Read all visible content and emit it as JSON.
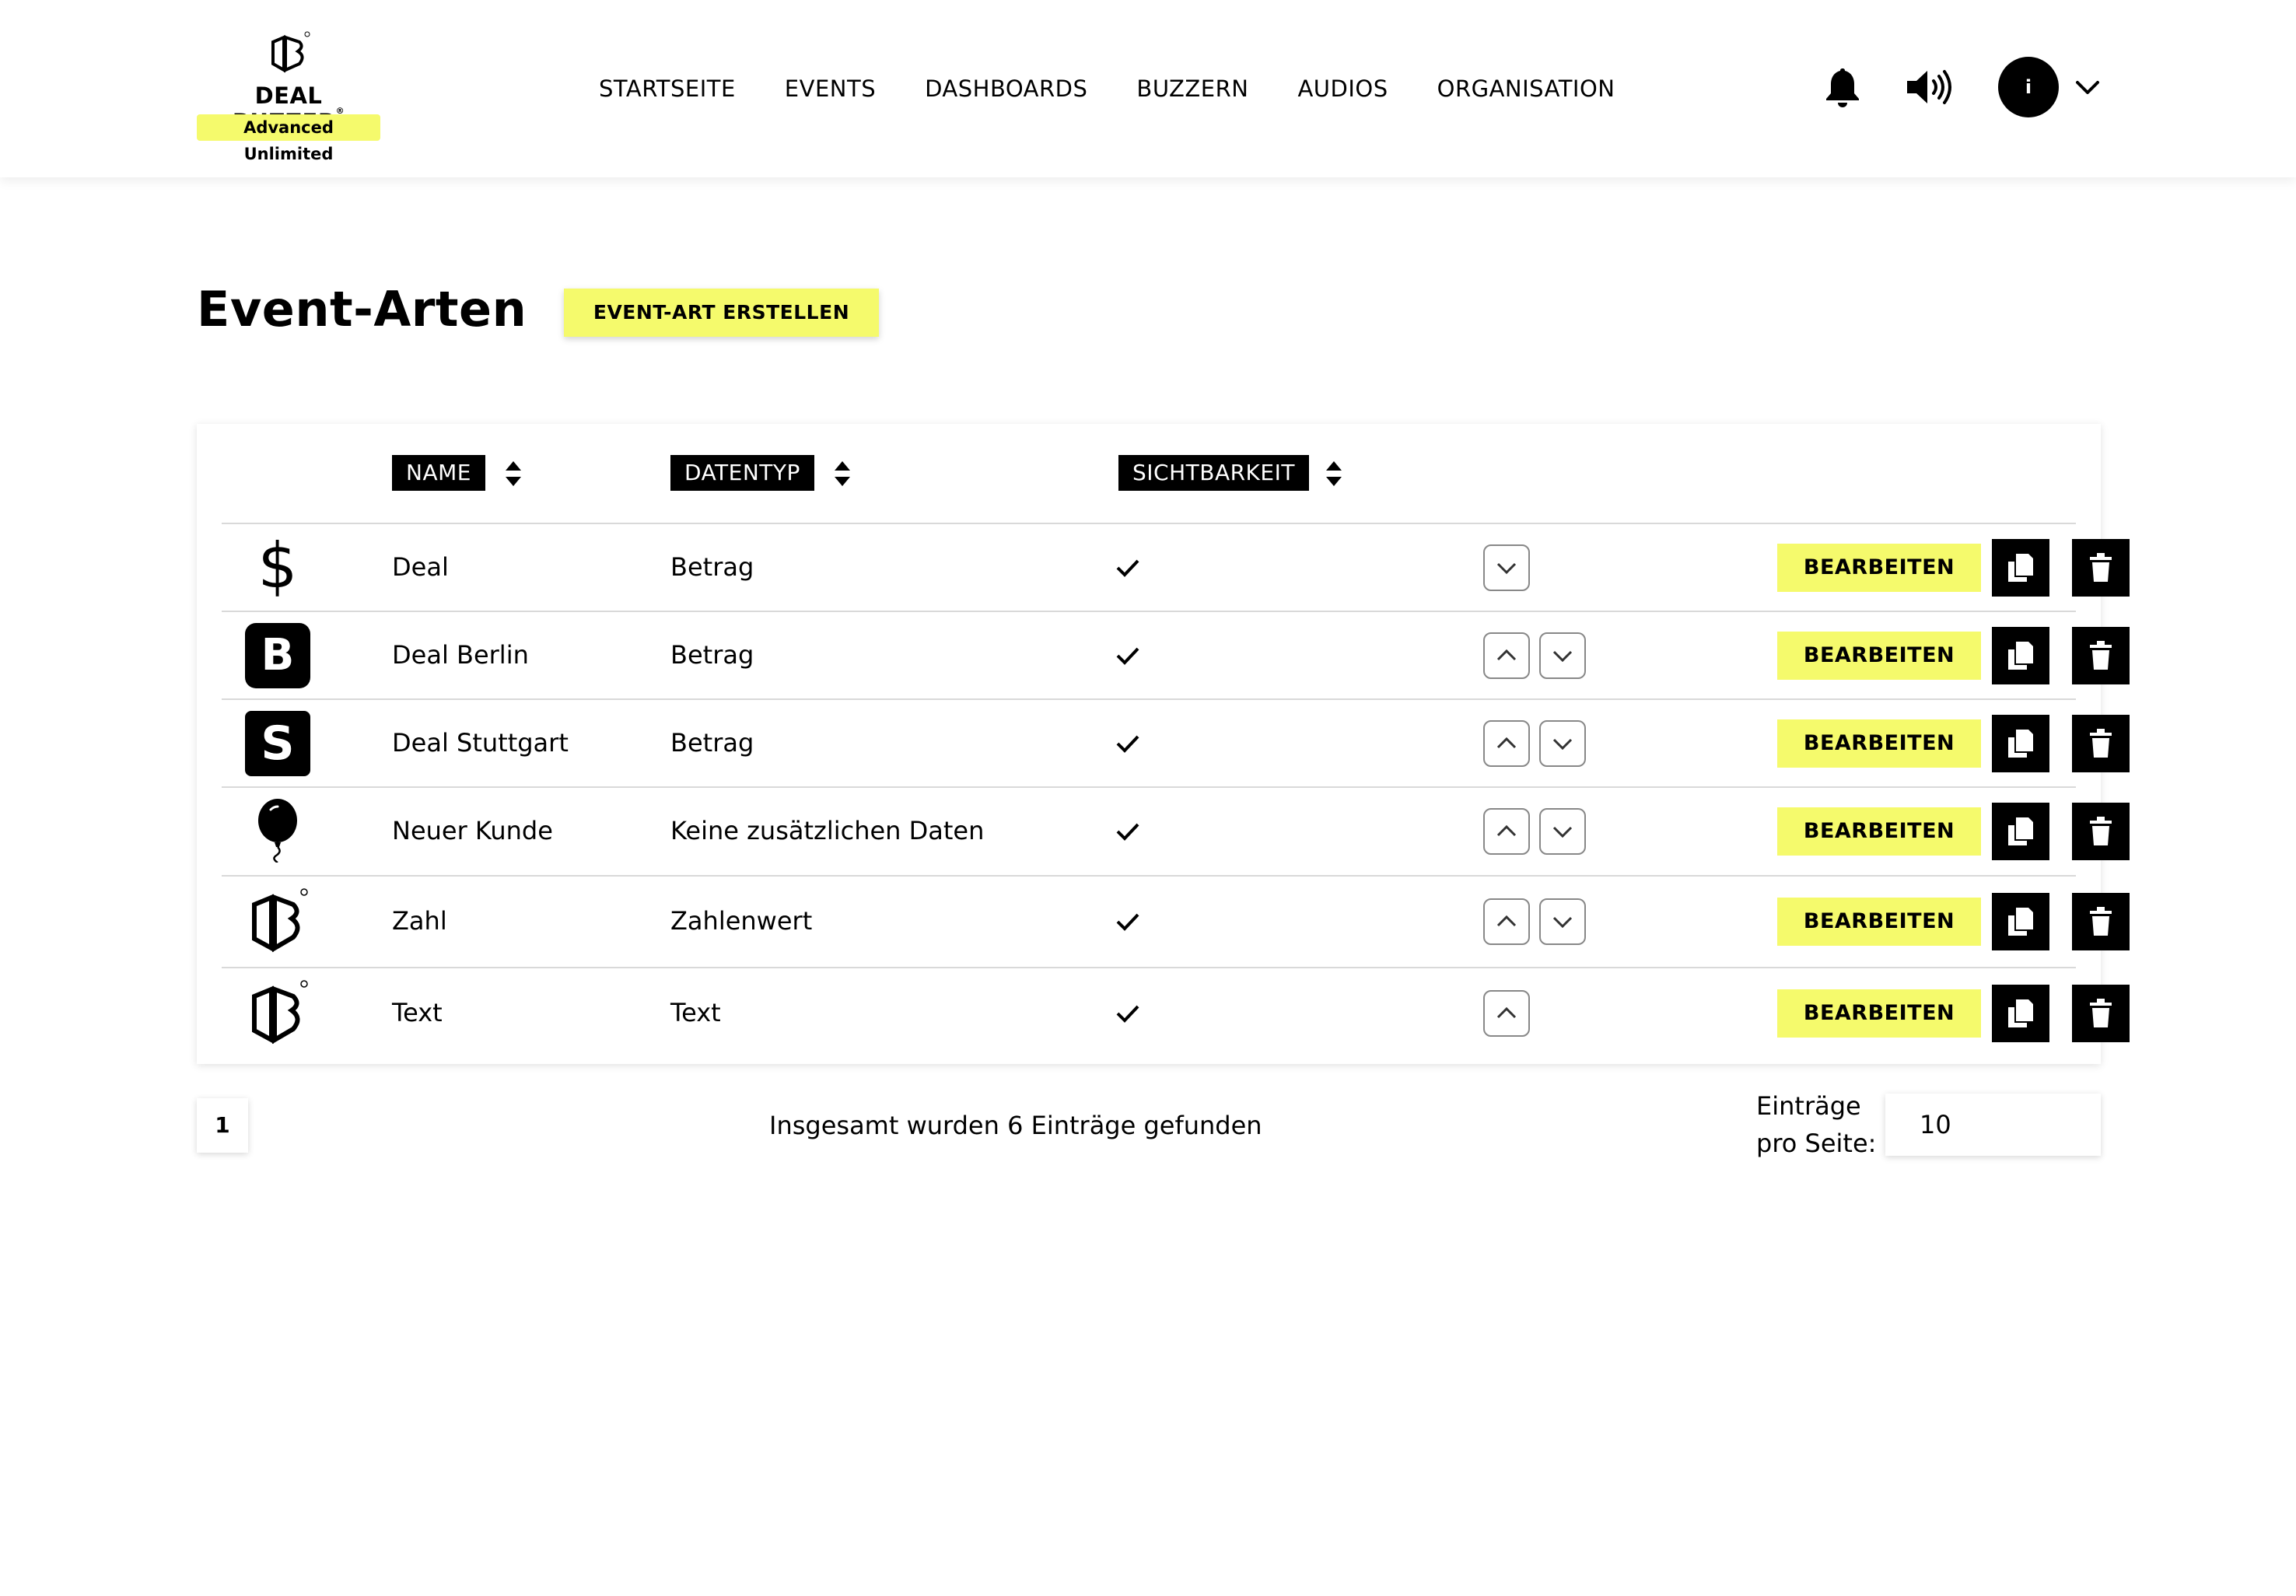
{
  "brand": {
    "name": "DEAL BUZZER",
    "registered": "®",
    "plan_badge": "Advanced Unlimited"
  },
  "nav": {
    "items": [
      "STARTSEITE",
      "EVENTS",
      "DASHBOARDS",
      "BUZZERN",
      "AUDIOS",
      "ORGANISATION"
    ]
  },
  "user": {
    "avatar_initial": "i"
  },
  "page": {
    "title": "Event-Arten",
    "create_button": "EVENT-ART ERSTELLEN"
  },
  "table": {
    "columns": [
      "NAME",
      "DATENTYP",
      "SICHTBARKEIT"
    ],
    "rows": [
      {
        "icon": "dollar-icon",
        "name": "Deal",
        "datatype": "Betrag",
        "visible": true,
        "can_move_up": false,
        "can_move_down": true
      },
      {
        "icon": "letter-b-icon",
        "name": "Deal Berlin",
        "datatype": "Betrag",
        "visible": true,
        "can_move_up": true,
        "can_move_down": true
      },
      {
        "icon": "letter-s-icon",
        "name": "Deal Stuttgart",
        "datatype": "Betrag",
        "visible": true,
        "can_move_up": true,
        "can_move_down": true
      },
      {
        "icon": "balloon-icon",
        "name": "Neuer Kunde",
        "datatype": "Keine zusätzlichen Daten",
        "visible": true,
        "can_move_up": true,
        "can_move_down": true
      },
      {
        "icon": "dealbuzzer-logo-icon",
        "name": "Zahl",
        "datatype": "Zahlenwert",
        "visible": true,
        "can_move_up": true,
        "can_move_down": true
      },
      {
        "icon": "dealbuzzer-logo-icon",
        "name": "Text",
        "datatype": "Text",
        "visible": true,
        "can_move_up": true,
        "can_move_down": false
      }
    ],
    "edit_label": "BEARBEITEN",
    "letter_b": "B",
    "letter_s": "S",
    "dollar": "$"
  },
  "pagination": {
    "current_page": "1",
    "total_text": "Insgesamt wurden 6 Einträge gefunden",
    "per_page_label_line1": "Einträge",
    "per_page_label_line2": "pro Seite:",
    "per_page_value": "10"
  },
  "colors": {
    "accent_yellow": "#f5fa6c",
    "black": "#000000"
  }
}
